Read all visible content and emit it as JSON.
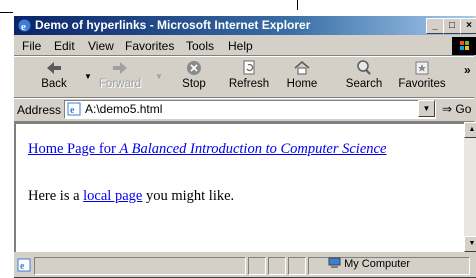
{
  "window": {
    "title": "Demo of hyperlinks - Microsoft Internet Explorer",
    "minimize": "_",
    "maximize": "□",
    "close": "×"
  },
  "menu": [
    {
      "label": "File"
    },
    {
      "label": "Edit"
    },
    {
      "label": "View"
    },
    {
      "label": "Favorites"
    },
    {
      "label": "Tools"
    },
    {
      "label": "Help"
    }
  ],
  "toolbar": {
    "back": "Back",
    "forward": "Forward",
    "stop": "Stop",
    "refresh": "Refresh",
    "home": "Home",
    "search": "Search",
    "favorites": "Favorites",
    "more": "»"
  },
  "address": {
    "label": "Address",
    "value": "A:\\demo5.html",
    "go": "Go"
  },
  "content": {
    "link1_prefix": "Home Page for ",
    "link1_title": "A Balanced Introduction to Computer Science",
    "line2_before": "Here is a ",
    "line2_link": "local page",
    "line2_after": " you might like."
  },
  "status": {
    "zone": "My Computer"
  }
}
